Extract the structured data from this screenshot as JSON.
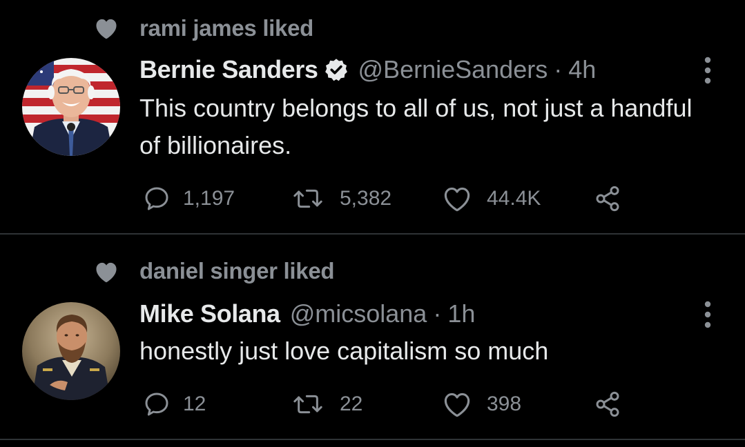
{
  "tweets": [
    {
      "context": "rami james liked",
      "name": "Bernie Sanders",
      "verified": true,
      "handle": "@BernieSanders",
      "separator": "·",
      "time": "4h",
      "text": "This country belongs to all of us, not just a handful of billionaires.",
      "replies": "1,197",
      "retweets": "5,382",
      "likes": "44.4K"
    },
    {
      "context": "daniel singer liked",
      "name": "Mike Solana",
      "verified": false,
      "handle": "@micsolana",
      "separator": "·",
      "time": "1h",
      "text": "honestly just love capitalism so much",
      "replies": "12",
      "retweets": "22",
      "likes": "398"
    }
  ],
  "icons": {
    "context": "heart-filled-icon",
    "verified": "verified-badge-icon",
    "more": "more-vertical-icon",
    "reply": "reply-icon",
    "retweet": "retweet-icon",
    "like": "heart-outline-icon",
    "share": "share-icon"
  },
  "colors": {
    "background": "#000000",
    "primary_text": "#e7e9ea",
    "secondary_text": "#8b9096",
    "divider": "#2f3336"
  }
}
